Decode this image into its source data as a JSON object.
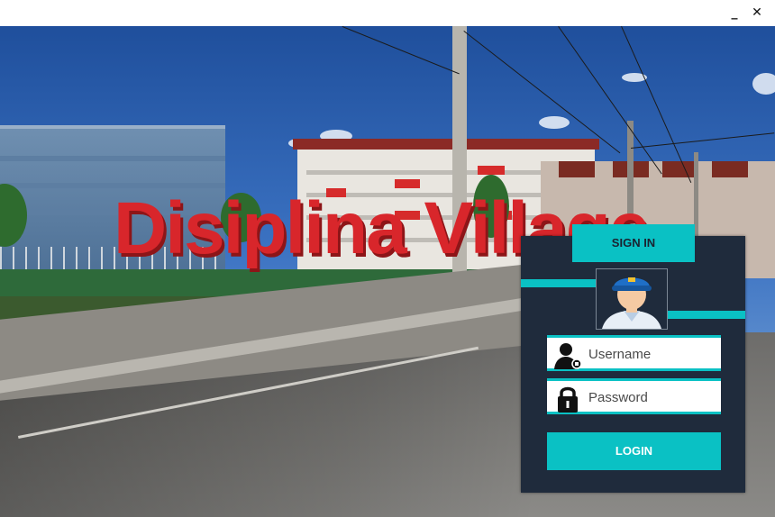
{
  "window": {
    "minimize_label": "_",
    "close_label": "✕"
  },
  "background": {
    "sign_text": "Disiplina Village",
    "sign_color": "#d8262b"
  },
  "login": {
    "tab_label": "SIGN IN",
    "avatar": "security-guard-avatar",
    "username_placeholder": "Username",
    "password_placeholder": "Password",
    "username_icon": "user-icon",
    "password_icon": "lock-icon",
    "login_button_label": "LOGIN",
    "accent_color": "#0ac1c4",
    "panel_color": "#1f2b3c"
  }
}
